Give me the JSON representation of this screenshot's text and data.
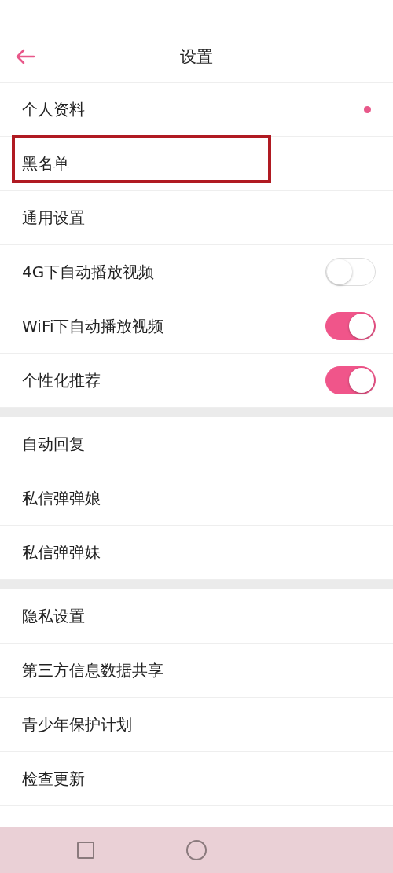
{
  "header": {
    "title": "设置"
  },
  "groups": [
    {
      "items": [
        {
          "kind": "link",
          "label": "个人资料",
          "dot": true,
          "annotated": false
        },
        {
          "kind": "link",
          "label": "黑名单",
          "dot": false,
          "annotated": true
        },
        {
          "kind": "link",
          "label": "通用设置",
          "dot": false,
          "annotated": false
        },
        {
          "kind": "toggle",
          "label": "4G下自动播放视频",
          "on": false
        },
        {
          "kind": "toggle",
          "label": "WiFi下自动播放视频",
          "on": true
        },
        {
          "kind": "toggle",
          "label": "个性化推荐",
          "on": true
        }
      ]
    },
    {
      "items": [
        {
          "kind": "link",
          "label": "自动回复",
          "dot": false,
          "annotated": false
        },
        {
          "kind": "link",
          "label": "私信弹弹娘",
          "dot": false,
          "annotated": false
        },
        {
          "kind": "link",
          "label": "私信弹弹妹",
          "dot": false,
          "annotated": false
        }
      ]
    },
    {
      "items": [
        {
          "kind": "link",
          "label": "隐私设置",
          "dot": false,
          "annotated": false
        },
        {
          "kind": "link",
          "label": "第三方信息数据共享",
          "dot": false,
          "annotated": false
        },
        {
          "kind": "link",
          "label": "青少年保护计划",
          "dot": false,
          "annotated": false
        },
        {
          "kind": "link",
          "label": "检查更新",
          "dot": false,
          "annotated": false
        }
      ]
    }
  ]
}
